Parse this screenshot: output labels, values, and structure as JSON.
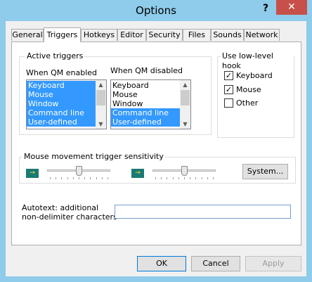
{
  "window": {
    "title": "Options",
    "help_glyph": "?",
    "close_glyph": "✕"
  },
  "tabs": [
    {
      "label": "General",
      "active": false
    },
    {
      "label": "Triggers",
      "active": true
    },
    {
      "label": "Hotkeys",
      "active": false
    },
    {
      "label": "Editor",
      "active": false
    },
    {
      "label": "Security",
      "active": false
    },
    {
      "label": "Files",
      "active": false
    },
    {
      "label": "Sounds",
      "active": false
    },
    {
      "label": "Network",
      "active": false
    }
  ],
  "active_triggers": {
    "group_label": "Active triggers",
    "enabled_label": "When QM enabled",
    "disabled_label": "When QM disabled",
    "enabled_list": [
      {
        "label": "Keyboard",
        "selected": true
      },
      {
        "label": "Mouse",
        "selected": true
      },
      {
        "label": "Window",
        "selected": true
      },
      {
        "label": "Command line",
        "selected": true
      },
      {
        "label": "User-defined",
        "selected": true
      }
    ],
    "disabled_list": [
      {
        "label": "Keyboard",
        "selected": false
      },
      {
        "label": "Mouse",
        "selected": false
      },
      {
        "label": "Window",
        "selected": false
      },
      {
        "label": "Command line",
        "selected": true
      },
      {
        "label": "User-defined",
        "selected": true
      }
    ]
  },
  "low_level_hook": {
    "group_label": "Use low-level hook",
    "options": [
      {
        "label": "Keyboard",
        "checked": true
      },
      {
        "label": "Mouse",
        "checked": true
      },
      {
        "label": "Other",
        "checked": false
      }
    ]
  },
  "sensitivity": {
    "group_label": "Mouse movement trigger sensitivity",
    "left_slider_value": 0.5,
    "right_slider_value": 0.5,
    "system_button": "System..."
  },
  "autotext": {
    "label_line1": "Autotext: additional",
    "label_line2": "non-delimiter characters",
    "value": ""
  },
  "buttons": {
    "ok": "OK",
    "cancel": "Cancel",
    "apply": "Apply"
  },
  "colors": {
    "titlebar": "#8fcbea",
    "selection": "#3399ff",
    "close": "#c7504a"
  }
}
